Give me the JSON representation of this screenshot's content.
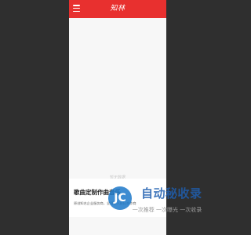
{
  "app": {
    "logo_text": "知林",
    "colors": {
      "brand": "#e8302f",
      "background": "#2f2f2f"
    }
  },
  "header": {
    "menu_icon": "hamburger-menu-icon"
  },
  "main": {
    "faded_text": "暂无数据"
  },
  "bottom_panel": {
    "title": "歌曲定制作曲音乐",
    "subtitle": "原创知名企业服务商，全国艺人经纪合作商"
  },
  "watermark": {
    "badge": "JC",
    "title": "自动秘收录",
    "slogan": "一次推荐 一次曝光 一次收录"
  }
}
